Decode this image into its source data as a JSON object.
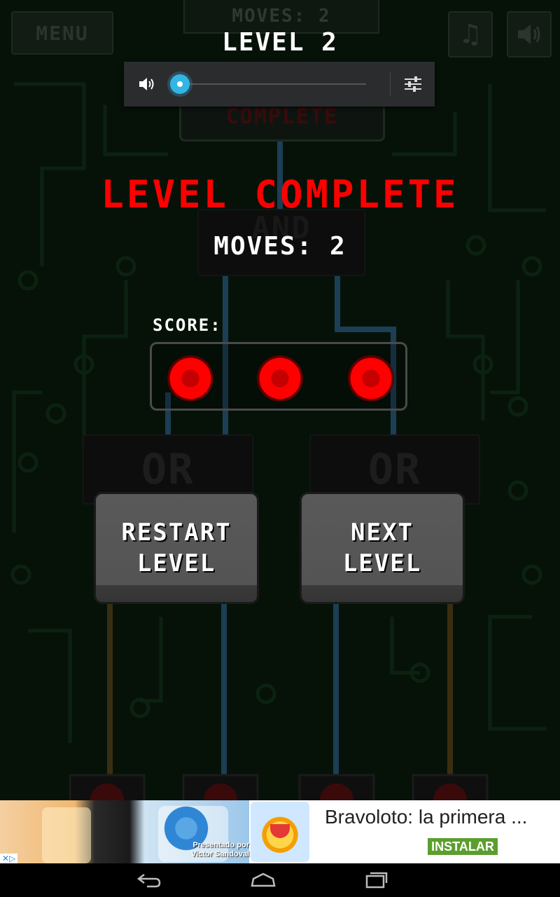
{
  "hud": {
    "menu_label": "MENU",
    "moves_label": "MOVES: 2",
    "music_icon": "music-note-icon",
    "sound_icon": "speaker-icon"
  },
  "level": {
    "title": "LEVEL 2"
  },
  "ghost": {
    "complete_text": "COMPLETE",
    "and_label": "AND"
  },
  "volume_popup": {
    "speaker_icon": "speaker-icon",
    "settings_icon": "sliders-icon",
    "level": 0,
    "accent": "#33b5e5"
  },
  "result": {
    "heading": "LEVEL COMPLETE",
    "moves": "MOVES: 2",
    "score_label": "SCORE:",
    "stars_earned": 3,
    "stars_total": 3,
    "accent": "#ff0000"
  },
  "gates": {
    "left_label": "OR",
    "right_label": "OR"
  },
  "buttons": {
    "restart": [
      "RESTART",
      "LEVEL"
    ],
    "next": [
      "NEXT",
      "LEVEL"
    ]
  },
  "ad": {
    "title": "Bravoloto: la primera ...",
    "install_label": "INSTALAR",
    "image_caption_1": "Presentado por",
    "image_caption_2": "Victor Sandoval",
    "adchoices_label": "✕▷",
    "install_color": "#5b9e2d"
  },
  "nav": {
    "back_icon": "back-icon",
    "home_icon": "home-icon",
    "recents_icon": "recents-icon"
  }
}
